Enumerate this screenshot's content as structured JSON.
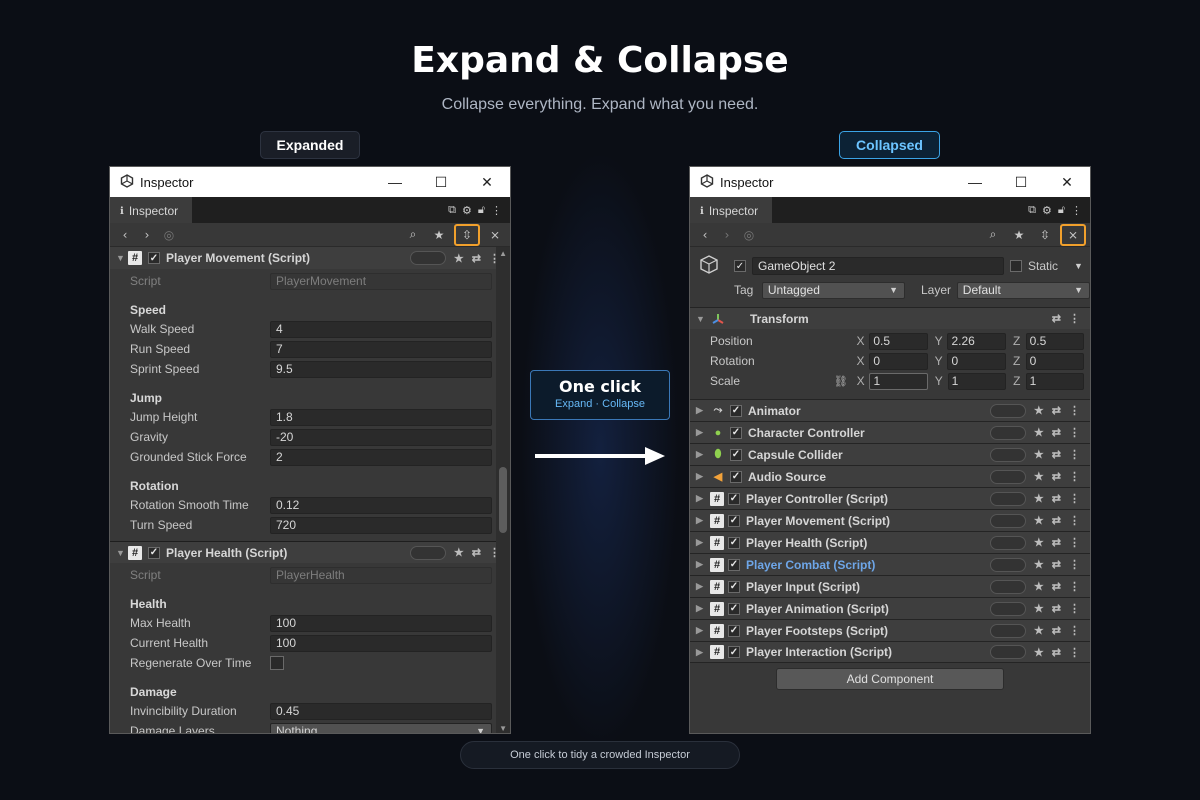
{
  "header": {
    "title": "Expand & Collapse",
    "subtitle": "Collapse everything. Expand what you need."
  },
  "labels": {
    "expanded": "Expanded",
    "collapsed": "Collapsed",
    "one_click": "One click",
    "expand_collapse": "Expand · Collapse",
    "footer": "One click to tidy a crowded Inspector"
  },
  "window": {
    "title": "Inspector",
    "tab": "Inspector"
  },
  "left": {
    "movement": {
      "title": "Player Movement (Script)",
      "script_label": "Script",
      "script_value": "PlayerMovement",
      "speed_section": "Speed",
      "walk_label": "Walk Speed",
      "walk_value": "4",
      "run_label": "Run Speed",
      "run_value": "7",
      "sprint_label": "Sprint Speed",
      "sprint_value": "9.5",
      "jump_section": "Jump",
      "jump_height_label": "Jump Height",
      "jump_height_value": "1.8",
      "gravity_label": "Gravity",
      "gravity_value": "-20",
      "stick_label": "Grounded Stick Force",
      "stick_value": "2",
      "rotation_section": "Rotation",
      "smooth_label": "Rotation Smooth Time",
      "smooth_value": "0.12",
      "turn_label": "Turn Speed",
      "turn_value": "720"
    },
    "health": {
      "title": "Player Health (Script)",
      "script_label": "Script",
      "script_value": "PlayerHealth",
      "health_section": "Health",
      "max_label": "Max Health",
      "max_value": "100",
      "current_label": "Current Health",
      "current_value": "100",
      "regen_label": "Regenerate Over Time",
      "damage_section": "Damage",
      "invinc_label": "Invincibility Duration",
      "invinc_value": "0.45",
      "layers_label": "Damage Layers",
      "layers_value": "Nothing"
    }
  },
  "right": {
    "gameobject": {
      "name": "GameObject 2",
      "static_label": "Static",
      "tag_label": "Tag",
      "tag_value": "Untagged",
      "layer_label": "Layer",
      "layer_value": "Default"
    },
    "transform": {
      "title": "Transform",
      "position_label": "Position",
      "rotation_label": "Rotation",
      "scale_label": "Scale",
      "x": "X",
      "y": "Y",
      "z": "Z",
      "pos": [
        "0.5",
        "2.26",
        "0.5"
      ],
      "rot": [
        "0",
        "0",
        "0"
      ],
      "scl": [
        "1",
        "1",
        "1"
      ]
    },
    "components": [
      "Animator",
      "Character Controller",
      "Capsule Collider",
      "Audio Source",
      "Player Controller (Script)",
      "Player Movement (Script)",
      "Player Health (Script)",
      "Player Combat (Script)",
      "Player Input (Script)",
      "Player Animation (Script)",
      "Player Footsteps (Script)",
      "Player Interaction (Script)"
    ],
    "add_component": "Add Component"
  },
  "colors": {
    "highlight_border": "#f1a02c",
    "accent_blue": "#3ba4e6",
    "selected_component": "#6ea6e8"
  }
}
